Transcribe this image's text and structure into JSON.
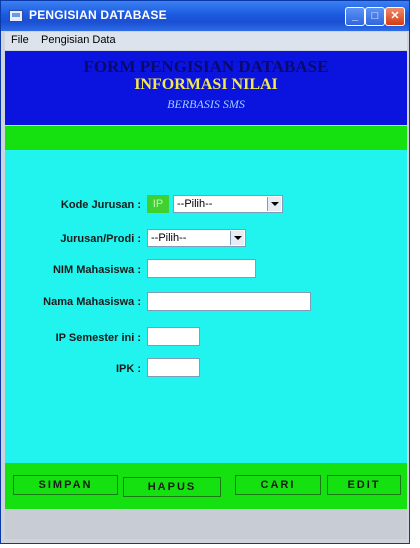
{
  "window": {
    "title": "PENGISIAN DATABASE"
  },
  "title_buttons": {
    "minimize": "_",
    "maximize": "□",
    "close": "✕"
  },
  "menu": {
    "items": [
      "File",
      "Pengisian Data"
    ]
  },
  "header": {
    "line1": "FORM PENGISIAN DATABASE",
    "line2": "INFORMASI NILAI",
    "line3": "BERBASIS SMS"
  },
  "form": {
    "kode_jurusan_label": "Kode Jurusan :",
    "kode_prefix": "IP",
    "kode_select_value": "--Pilih--",
    "jurusan_label": "Jurusan/Prodi :",
    "jurusan_select_value": "--Pilih--",
    "nim_label": "NIM Mahasiswa :",
    "nim_value": "",
    "nama_label": "Nama Mahasiswa :",
    "nama_value": "",
    "ip_label": "IP Semester ini :",
    "ip_value": "",
    "ipk_label": "IPK :",
    "ipk_value": ""
  },
  "buttons": {
    "simpan": "SIMPAN",
    "hapus": "HAPUS",
    "cari": "CARI",
    "edit": "EDIT"
  },
  "colors": {
    "header_bg": "#0b14de",
    "form_bg": "#21f3ee",
    "green": "#16e110"
  }
}
